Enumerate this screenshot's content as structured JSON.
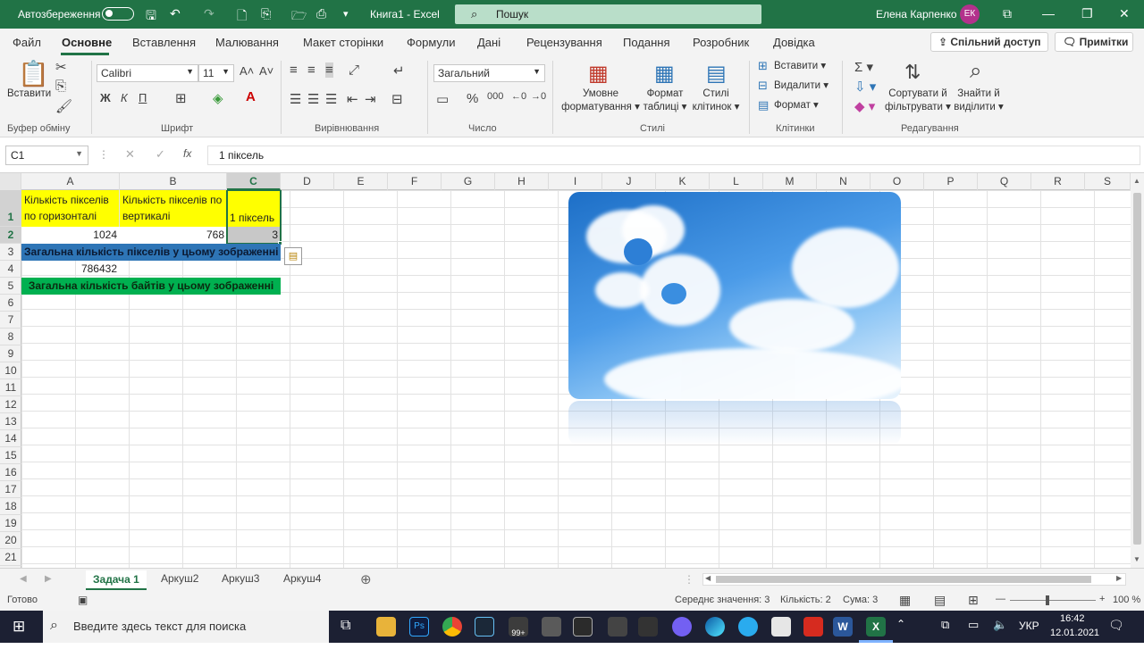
{
  "titlebar": {
    "autosave": "Автозбереження",
    "filename": "Книга1 - Excel",
    "search": "Пошук",
    "user": "Елена Карпенко",
    "initials": "ЕК"
  },
  "menu": {
    "tabs": [
      "Файл",
      "Основне",
      "Вставлення",
      "Малювання",
      "Макет сторінки",
      "Формули",
      "Дані",
      "Рецензування",
      "Подання",
      "Розробник",
      "Довідка"
    ],
    "share": "Спільний доступ",
    "comments": "Примітки"
  },
  "ribbon": {
    "paste": "Вставити",
    "font_name": "Calibri",
    "font_size": "11",
    "bold": "Ж",
    "italic": "К",
    "underline": "П",
    "number_format": "Загальний",
    "cond_format": [
      "Умовне",
      "форматування"
    ],
    "format_table": [
      "Формат",
      "таблиці"
    ],
    "cell_styles": [
      "Стилі",
      "клітинок"
    ],
    "insert": "Вставити",
    "delete": "Видалити",
    "format": "Формат",
    "sort": [
      "Сортувати й",
      "фільтрувати"
    ],
    "find": [
      "Знайти й",
      "виділити"
    ],
    "groups": [
      "Буфер обміну",
      "Шрифт",
      "Вирівнювання",
      "Число",
      "Стилі",
      "Клітинки",
      "Редагування"
    ]
  },
  "formula_bar": {
    "cell_ref": "C1",
    "fx": "fx",
    "content": "1 піксель"
  },
  "columns": [
    "A",
    "B",
    "C",
    "D",
    "E",
    "F",
    "G",
    "H",
    "I",
    "J",
    "K",
    "L",
    "M",
    "N",
    "O",
    "P",
    "Q",
    "R",
    "S"
  ],
  "rows": [
    "1",
    "2",
    "3",
    "4",
    "5",
    "6",
    "7",
    "8",
    "9",
    "10",
    "11",
    "12",
    "13",
    "14",
    "15",
    "16",
    "17",
    "18",
    "19",
    "20",
    "21"
  ],
  "cells": {
    "a1": "Кількість пікселів по горизонталі",
    "b1": "Кількість пікселів по вертикалі",
    "c1": "1 піксель",
    "a2": "1024",
    "b2": "768",
    "c2": "3",
    "a3": "Загальна кількість пікселів у цьому зображенні",
    "a4": "786432",
    "a5": "Загальна кількість байтів у цьому зображенні"
  },
  "sheets": [
    "Задача 1",
    "Аркуш2",
    "Аркуш3",
    "Аркуш4"
  ],
  "status": {
    "ready": "Готово",
    "average": "Середнє значення: 3",
    "count": "Кількість: 2",
    "sum": "Сума: 3",
    "zoom": "100 %"
  },
  "taskbar": {
    "search": "Введите здесь текст для поиска",
    "badge": "99+",
    "lang": "УКР",
    "time": "16:42",
    "date": "12.01.2021"
  },
  "colors": {
    "excel_green": "#217346",
    "yellow": "#ffff00",
    "blue": "#2e75b6",
    "green": "#00b050"
  }
}
